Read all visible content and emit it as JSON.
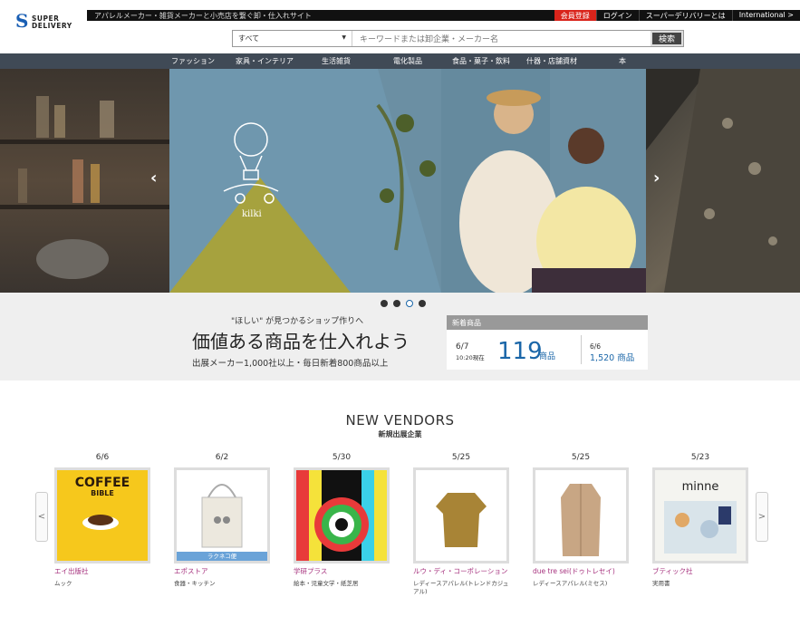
{
  "header": {
    "logo_super": "SUPER",
    "logo_delivery": "DELIVERY",
    "tagline": "アパレルメーカー・雑貨メーカーと小売店を繋ぐ卸・仕入れサイト",
    "register": "会員登録",
    "login": "ログイン",
    "about": "スーパーデリバリーとは",
    "international": "International >"
  },
  "search": {
    "category": "すべて",
    "placeholder": "キーワードまたは卸企業・メーカー名",
    "button": "検索"
  },
  "nav": [
    "ファッション",
    "家具・インテリア",
    "生活雑貨",
    "電化製品",
    "食品・菓子・飲料",
    "什器・店舗資材",
    "本"
  ],
  "hero": {
    "brand": "kilki",
    "prev": "‹",
    "next": "›"
  },
  "promo": {
    "line1": "\"ほしい\" が見つかるショップ作りへ",
    "line2": "価値ある商品を仕入れよう",
    "line3": "出展メーカー1,000社以上・毎日新着800商品以上",
    "new_title": "新着商品",
    "today_date": "6/7",
    "today_time": "10:20現在",
    "today_count": "119",
    "unit": "商品",
    "prev_date": "6/6",
    "prev_value": "1,520 商品",
    "slide_active": 3
  },
  "vendors": {
    "title": "NEW VENDORS",
    "subtitle": "新規出展企業",
    "items": [
      {
        "date": "6/6",
        "name": "エイ出版社",
        "category": "ムック",
        "ribbon": ""
      },
      {
        "date": "6/2",
        "name": "エポストア",
        "category": "食器・キッチン",
        "ribbon": "ラクネコ便"
      },
      {
        "date": "5/30",
        "name": "学研プラス",
        "category": "絵本・児童文学・紙芝居",
        "ribbon": ""
      },
      {
        "date": "5/25",
        "name": "ルウ・ディ・コーポレーション",
        "category": "レディースアパレル(トレンドカジュアル)",
        "ribbon": ""
      },
      {
        "date": "5/25",
        "name": "due tre sei(ドゥトレセイ)",
        "category": "レディースアパレル(ミセス)",
        "ribbon": ""
      },
      {
        "date": "5/23",
        "name": "ブティック社",
        "category": "実用書",
        "ribbon": ""
      }
    ]
  }
}
